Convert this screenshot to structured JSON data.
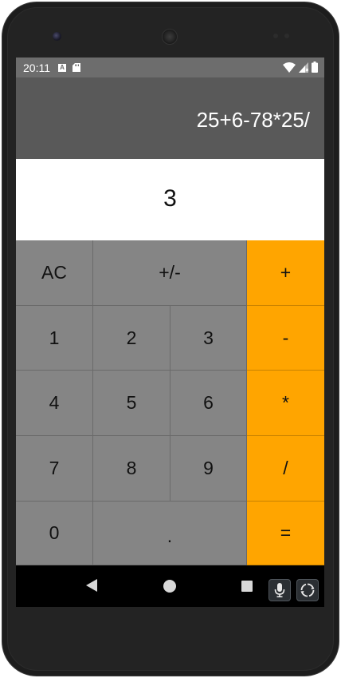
{
  "status_bar": {
    "time": "20:11",
    "notification_a_label": "A"
  },
  "calculator": {
    "expression": "25+6-78*25/",
    "result": "3",
    "keys": {
      "ac": "AC",
      "plus_minus": "+/-",
      "add": "+",
      "one": "1",
      "two": "2",
      "three": "3",
      "subtract": "-",
      "four": "4",
      "five": "5",
      "six": "6",
      "multiply": "*",
      "seven": "7",
      "eight": "8",
      "nine": "9",
      "divide": "/",
      "zero": "0",
      "decimal": ".",
      "equals": "="
    }
  },
  "icons": {
    "camera": "camera-icon",
    "speaker": "speaker-icon",
    "wifi": "wifi-icon",
    "signal": "signal-icon",
    "battery": "battery-icon",
    "sd_card": "sd-card-icon",
    "nav_back": "back-icon",
    "nav_home": "home-icon",
    "nav_recents": "recents-icon",
    "mic": "microphone-icon",
    "rotate": "rotate-icon"
  },
  "colors": {
    "operator_key": "#ffa500",
    "number_key": "#858585",
    "expression_bg": "#595959",
    "result_bg": "#ffffff",
    "status_bar": "#6d6d6d"
  }
}
